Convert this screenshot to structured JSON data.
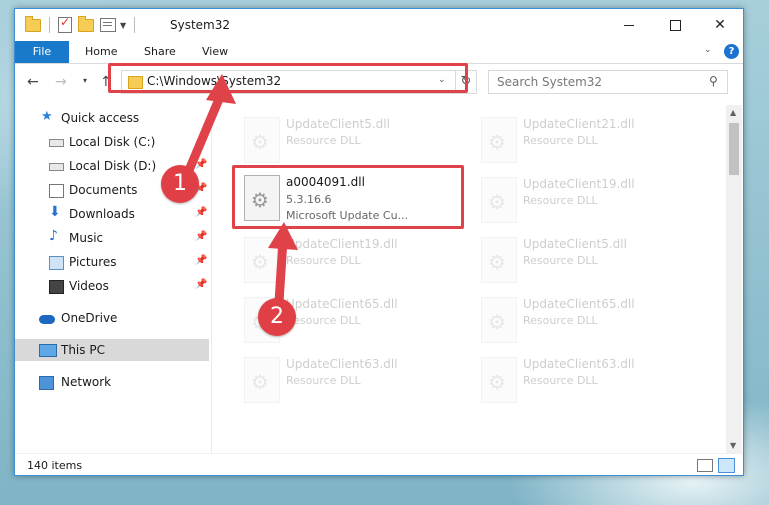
{
  "window": {
    "title": "System32",
    "minimize_icon": "minimize-icon",
    "maximize_icon": "maximize-icon",
    "close_glyph": "✕"
  },
  "ribbon": {
    "tabs": [
      "File",
      "Home",
      "Share",
      "View"
    ],
    "help_glyph": "?"
  },
  "navigation": {
    "back_glyph": "←",
    "forward_glyph": "→",
    "recent_glyph": "⌄",
    "up_glyph": "↑",
    "address": "C:\\Windows\\System32",
    "refresh_glyph": "↻",
    "search_placeholder": "Search System32",
    "search_glyph": "⚲"
  },
  "sidebar": {
    "items": [
      {
        "label": "Quick access",
        "icon": "star-icon"
      },
      {
        "label": "Local Disk (C:)",
        "icon": "disk-icon"
      },
      {
        "label": "Local Disk (D:)",
        "icon": "disk-icon",
        "pinned": true
      },
      {
        "label": "Documents",
        "icon": "documents-icon",
        "pinned": true
      },
      {
        "label": "Downloads",
        "icon": "downloads-icon",
        "pinned": true
      },
      {
        "label": "Music",
        "icon": "music-icon",
        "pinned": true
      },
      {
        "label": "Pictures",
        "icon": "pictures-icon",
        "pinned": true
      },
      {
        "label": "Videos",
        "icon": "videos-icon",
        "pinned": true
      },
      {
        "label": "OneDrive",
        "icon": "onedrive-icon"
      },
      {
        "label": "This PC",
        "icon": "this-pc-icon"
      },
      {
        "label": "Network",
        "icon": "network-icon"
      }
    ],
    "pin_glyph": "📌"
  },
  "files": {
    "selected": {
      "name": "a0004091.dll",
      "version": "5.3.16.6",
      "description": "Microsoft Update Cu..."
    },
    "ghost_tiles": [
      {
        "name": "UpdateClient5.dll",
        "type": "Resource DLL"
      },
      {
        "name": "UpdateClient21.dll",
        "type": "Resource DLL"
      },
      {
        "name": "UpdateClient19.dll",
        "type": "Resource DLL"
      },
      {
        "name": "UpdateClient19.dll",
        "type": "Resource DLL"
      },
      {
        "name": "UpdateClient5.dll",
        "type": "Resource DLL"
      },
      {
        "name": "UpdateClient65.dll",
        "type": "Resource DLL"
      },
      {
        "name": "UpdateClient65.dll",
        "type": "Resource DLL"
      },
      {
        "name": "UpdateClient63.dll",
        "type": "Resource DLL"
      },
      {
        "name": "UpdateClient63.dll",
        "type": "Resource DLL"
      }
    ]
  },
  "status": {
    "item_count": "140 items"
  },
  "annotations": {
    "step1": "1",
    "step2": "2",
    "highlight_color": "#e0424a"
  }
}
